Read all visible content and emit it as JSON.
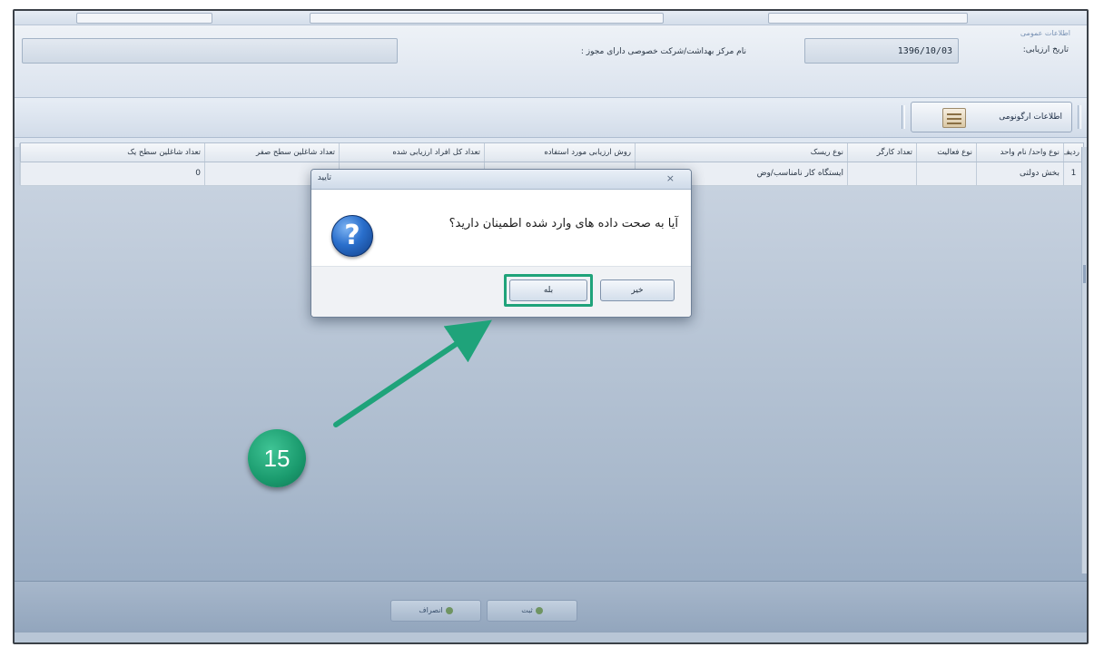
{
  "header": {
    "panel_caption": "اطلاعات عمومی",
    "date_label": "تاریخ ارزیابی:",
    "date_value": "1396/10/03",
    "center_label": "نام مرکز بهداشت/شرکت خصوصی دارای مجوز :"
  },
  "toolbar": {
    "ergonomics_button_label": "اطلاعات ارگونومی"
  },
  "grid": {
    "columns": [
      "ردیف",
      "نوع واحد/ نام واحد",
      "نوع فعالیت",
      "تعداد کارگر",
      "نوع ریسک",
      "روش ارزیابی مورد استفاده",
      "تعداد کل افراد ارزیابی شده",
      "تعداد شاغلین سطح صفر",
      "تعداد شاغلین سطح یک"
    ],
    "rows": [
      {
        "row_no": "1",
        "unit": "بخش دولتی",
        "activity": "",
        "workers": "",
        "risk": "ایستگاه کار نامناسب/وض",
        "method": "",
        "total_assessed": "",
        "level_zero": "",
        "level_one": "0"
      }
    ]
  },
  "dialog": {
    "title": "تایید",
    "close_glyph": "×",
    "question_glyph": "?",
    "message": "آیا به صحت داده های وارد شده اطمینان دارید؟",
    "yes_label": "بله",
    "no_label": "خیر"
  },
  "bottom": {
    "register_label": "ثبت",
    "return_label": "انصراف"
  },
  "annotation": {
    "step_number": "15",
    "accent_color": "#1fa37a"
  }
}
